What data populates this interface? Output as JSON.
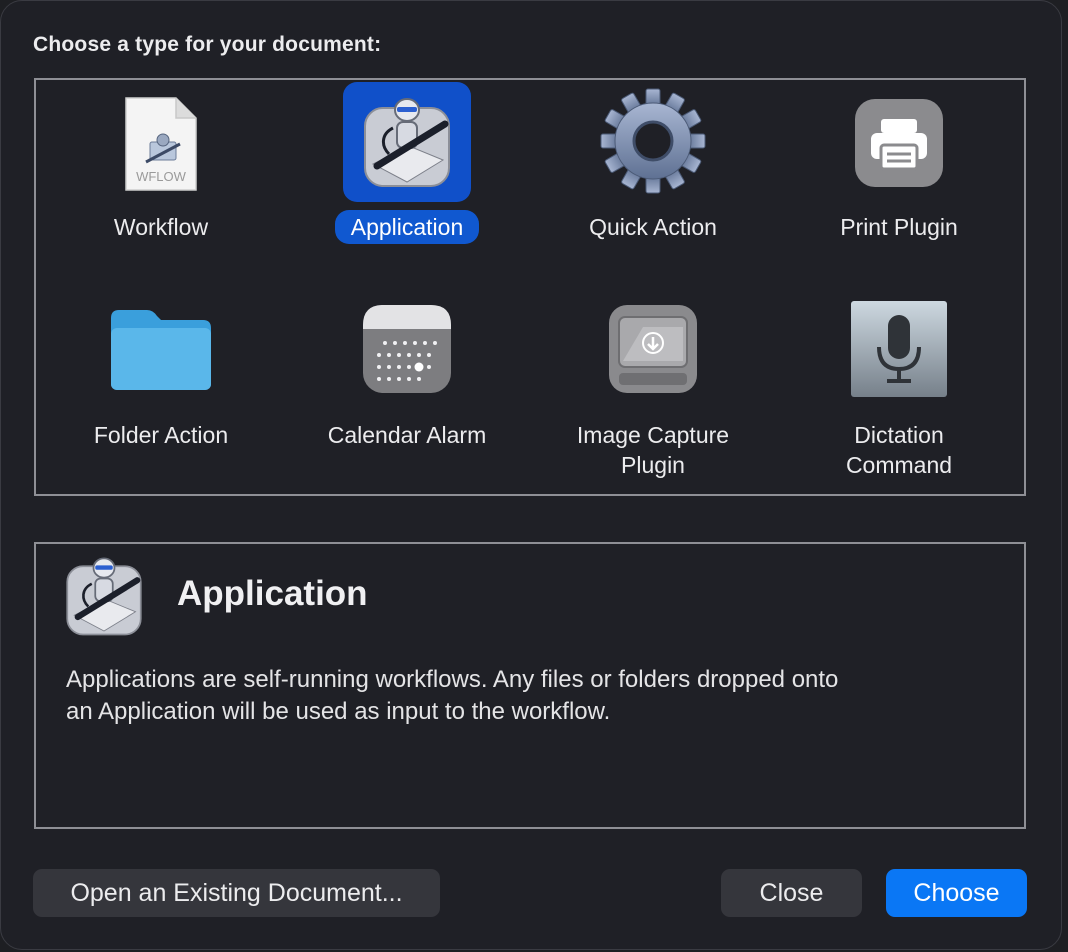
{
  "heading": "Choose a type for your document:",
  "types": [
    {
      "label_lines": [
        "Workflow"
      ],
      "icon": "workflow-file-icon",
      "icon_text": "WFLOW"
    },
    {
      "label_lines": [
        "Application"
      ],
      "icon": "automator-robot-icon",
      "selected": true
    },
    {
      "label_lines": [
        "Quick Action"
      ],
      "icon": "gear-icon"
    },
    {
      "label_lines": [
        "Print Plugin"
      ],
      "icon": "printer-icon"
    },
    {
      "label_lines": [
        "Folder Action"
      ],
      "icon": "folder-icon"
    },
    {
      "label_lines": [
        "Calendar Alarm"
      ],
      "icon": "calendar-icon"
    },
    {
      "label_lines": [
        "Image Capture",
        "Plugin"
      ],
      "icon": "image-capture-icon"
    },
    {
      "label_lines": [
        "Dictation",
        "Command"
      ],
      "icon": "microphone-icon"
    }
  ],
  "description": {
    "title": "Application",
    "text_line1": "Applications are self-running workflows. Any files or folders dropped onto",
    "text_line2": "an Application will be used as input to the workflow."
  },
  "buttons": {
    "open_existing": "Open an Existing Document...",
    "close": "Close",
    "choose": "Choose"
  },
  "colors": {
    "accent": "#0a77f5",
    "selection": "#1050c9",
    "background": "#1f2026"
  }
}
